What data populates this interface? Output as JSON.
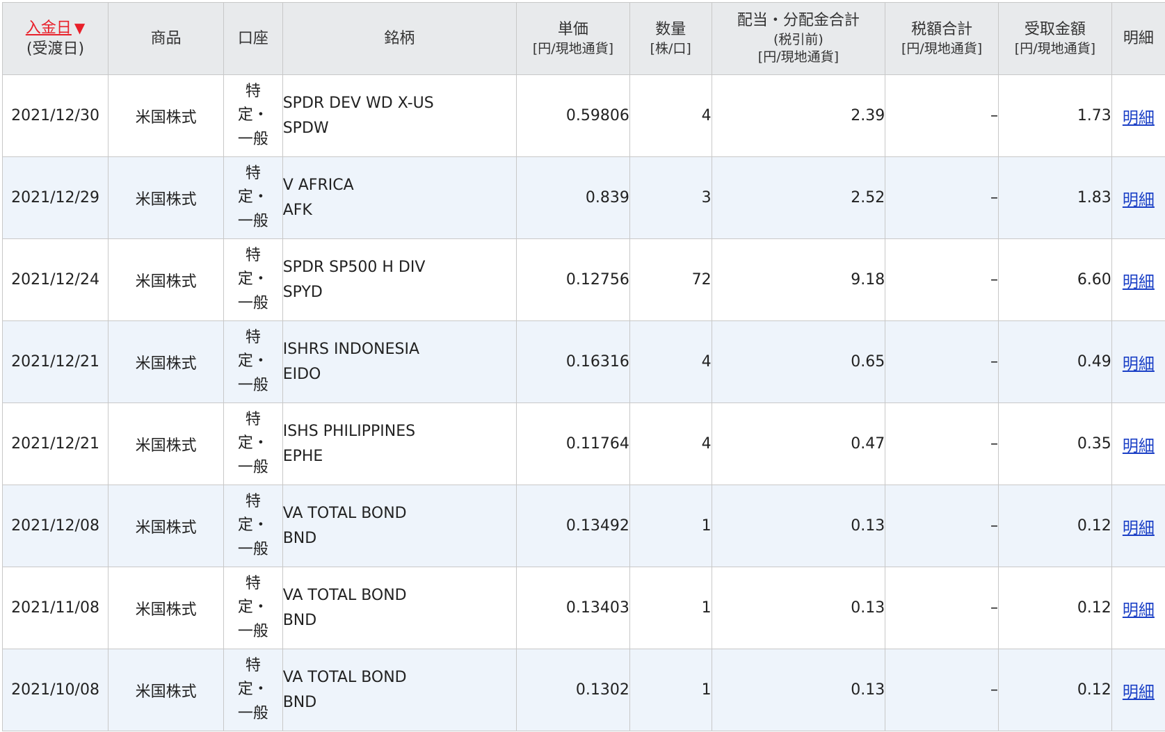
{
  "headers": {
    "date": {
      "main": "入金日",
      "arrow": "▼",
      "sub": "(受渡日)"
    },
    "product": {
      "main": "商品"
    },
    "account": {
      "main": "口座"
    },
    "name": {
      "main": "銘柄"
    },
    "unit_price": {
      "main": "単価",
      "sub": "[円/現地通貨]"
    },
    "quantity": {
      "main": "数量",
      "sub": "[株/口]"
    },
    "dividend": {
      "main": "配当・分配金合計",
      "sub1": "(税引前)",
      "sub2": "[円/現地通貨]"
    },
    "tax": {
      "main": "税額合計",
      "sub": "[円/現地通貨]"
    },
    "received": {
      "main": "受取金額",
      "sub": "[円/現地通貨]"
    },
    "detail": {
      "main": "明細"
    }
  },
  "rows": [
    {
      "date": "2021/12/30",
      "product": "米国株式",
      "account": [
        "特",
        "定・",
        "一般"
      ],
      "name1": "SPDR DEV WD X-US",
      "name2": "SPDW",
      "unit_price": "0.59806",
      "quantity": "4",
      "dividend": "2.39",
      "tax": "–",
      "received": "1.73",
      "detail": "明細"
    },
    {
      "date": "2021/12/29",
      "product": "米国株式",
      "account": [
        "特",
        "定・",
        "一般"
      ],
      "name1": "V AFRICA",
      "name2": "AFK",
      "unit_price": "0.839",
      "quantity": "3",
      "dividend": "2.52",
      "tax": "–",
      "received": "1.83",
      "detail": "明細"
    },
    {
      "date": "2021/12/24",
      "product": "米国株式",
      "account": [
        "特",
        "定・",
        "一般"
      ],
      "name1": "SPDR SP500 H DIV",
      "name2": "SPYD",
      "unit_price": "0.12756",
      "quantity": "72",
      "dividend": "9.18",
      "tax": "–",
      "received": "6.60",
      "detail": "明細"
    },
    {
      "date": "2021/12/21",
      "product": "米国株式",
      "account": [
        "特",
        "定・",
        "一般"
      ],
      "name1": "ISHRS INDONESIA",
      "name2": "EIDO",
      "unit_price": "0.16316",
      "quantity": "4",
      "dividend": "0.65",
      "tax": "–",
      "received": "0.49",
      "detail": "明細"
    },
    {
      "date": "2021/12/21",
      "product": "米国株式",
      "account": [
        "特",
        "定・",
        "一般"
      ],
      "name1": "ISHS PHILIPPINES",
      "name2": "EPHE",
      "unit_price": "0.11764",
      "quantity": "4",
      "dividend": "0.47",
      "tax": "–",
      "received": "0.35",
      "detail": "明細"
    },
    {
      "date": "2021/12/08",
      "product": "米国株式",
      "account": [
        "特",
        "定・",
        "一般"
      ],
      "name1": "VA TOTAL BOND",
      "name2": "BND",
      "unit_price": "0.13492",
      "quantity": "1",
      "dividend": "0.13",
      "tax": "–",
      "received": "0.12",
      "detail": "明細"
    },
    {
      "date": "2021/11/08",
      "product": "米国株式",
      "account": [
        "特",
        "定・",
        "一般"
      ],
      "name1": "VA TOTAL BOND",
      "name2": "BND",
      "unit_price": "0.13403",
      "quantity": "1",
      "dividend": "0.13",
      "tax": "–",
      "received": "0.12",
      "detail": "明細"
    },
    {
      "date": "2021/10/08",
      "product": "米国株式",
      "account": [
        "特",
        "定・",
        "一般"
      ],
      "name1": "VA TOTAL BOND",
      "name2": "BND",
      "unit_price": "0.1302",
      "quantity": "1",
      "dividend": "0.13",
      "tax": "–",
      "received": "0.12",
      "detail": "明細"
    }
  ]
}
